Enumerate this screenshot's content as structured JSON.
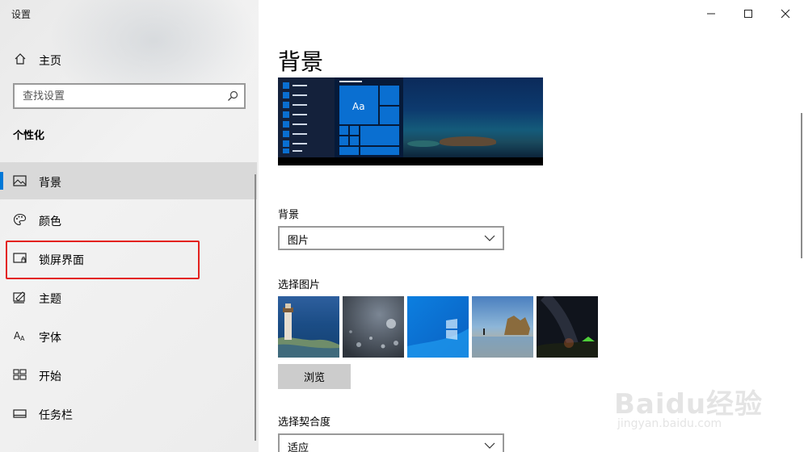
{
  "window": {
    "title": "设置"
  },
  "sidebar": {
    "home_label": "主页",
    "search_placeholder": "查找设置",
    "section_title": "个性化",
    "items": [
      {
        "label": "背景",
        "icon": "picture-icon",
        "selected": true
      },
      {
        "label": "颜色",
        "icon": "palette-icon",
        "selected": false
      },
      {
        "label": "锁屏界面",
        "icon": "lock-screen-icon",
        "selected": false
      },
      {
        "label": "主题",
        "icon": "theme-icon",
        "selected": false
      },
      {
        "label": "字体",
        "icon": "font-icon",
        "selected": false
      },
      {
        "label": "开始",
        "icon": "start-icon",
        "selected": false
      },
      {
        "label": "任务栏",
        "icon": "taskbar-icon",
        "selected": false
      }
    ]
  },
  "main": {
    "page_title": "背景",
    "background_label": "背景",
    "background_value": "图片",
    "choose_picture_label": "选择图片",
    "browse_label": "浏览",
    "fit_label": "选择契合度",
    "fit_value": "适应",
    "preview_tile_text": "Aa"
  },
  "watermark": {
    "text": "Baidu经验",
    "sub": "jingyan.baidu.com"
  },
  "colors": {
    "accent": "#0078d7",
    "highlight": "#e3211d",
    "selected_bg": "#d9d9d9"
  }
}
